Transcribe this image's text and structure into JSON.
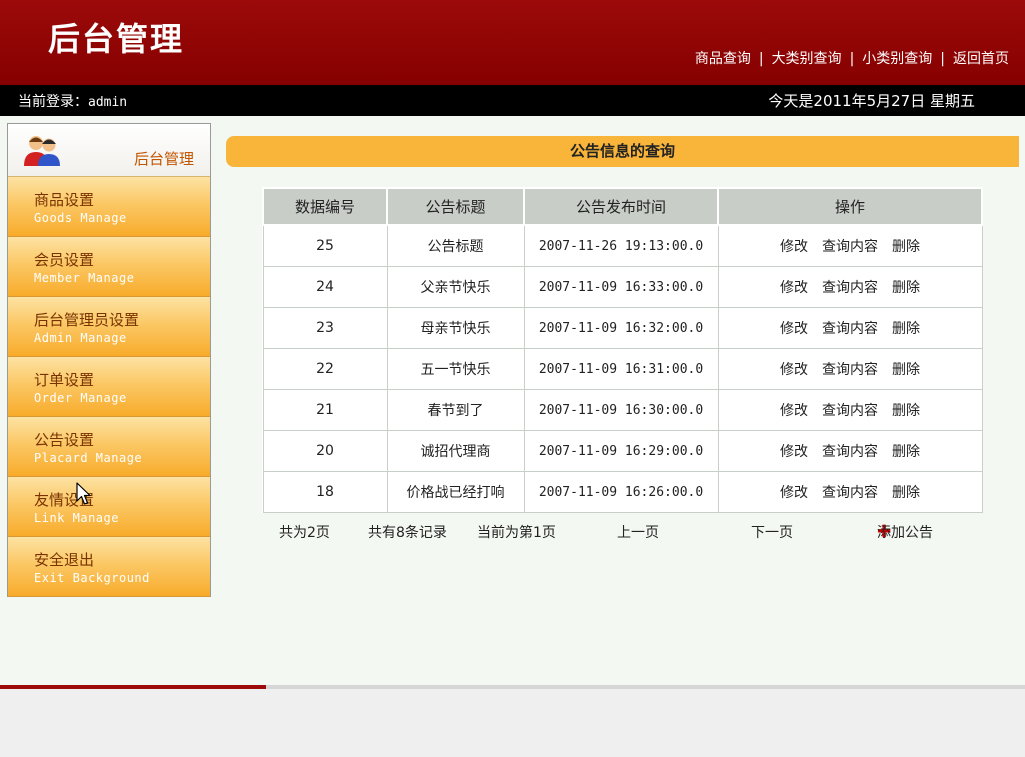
{
  "header": {
    "brand": "后台管理",
    "nav": [
      {
        "label": "商品查询"
      },
      {
        "label": "大类别查询"
      },
      {
        "label": "小类别查询"
      },
      {
        "label": "返回首页"
      }
    ]
  },
  "infobar": {
    "login_label": "当前登录：",
    "login_user": "admin",
    "date_text": "今天是2011年5月27日  星期五"
  },
  "sidebar": {
    "title": "后台管理",
    "icon": "users-icon",
    "items": [
      {
        "label": "商品设置",
        "sub": "Goods Manage"
      },
      {
        "label": "会员设置",
        "sub": "Member Manage"
      },
      {
        "label": "后台管理员设置",
        "sub": "Admin Manage"
      },
      {
        "label": "订单设置",
        "sub": "Order Manage"
      },
      {
        "label": "公告设置",
        "sub": "Placard Manage"
      },
      {
        "label": "友情设置",
        "sub": "Link Manage"
      },
      {
        "label": "安全退出",
        "sub": "Exit Background"
      }
    ]
  },
  "main": {
    "title": "公告信息的查询",
    "table": {
      "headers": [
        "数据编号",
        "公告标题",
        "公告发布时间",
        "操作"
      ],
      "actions": [
        "修改",
        "查询内容",
        "删除"
      ],
      "rows": [
        {
          "id": "25",
          "title": "公告标题",
          "time": "2007-11-26 19:13:00.0"
        },
        {
          "id": "24",
          "title": "父亲节快乐",
          "time": "2007-11-09 16:33:00.0"
        },
        {
          "id": "23",
          "title": "母亲节快乐",
          "time": "2007-11-09 16:32:00.0"
        },
        {
          "id": "22",
          "title": "五一节快乐",
          "time": "2007-11-09 16:31:00.0"
        },
        {
          "id": "21",
          "title": "春节到了",
          "time": "2007-11-09 16:30:00.0"
        },
        {
          "id": "20",
          "title": "诚招代理商",
          "time": "2007-11-09 16:29:00.0"
        },
        {
          "id": "18",
          "title": "价格战已经打响",
          "time": "2007-11-09 16:26:00.0"
        }
      ]
    },
    "pager": {
      "total_pages": "共为2页",
      "total_records": "共有8条记录",
      "current_page": "当前为第1页",
      "prev": "上一页",
      "next": "下一页",
      "add": "添加公告",
      "add_icon": "plus-icon"
    }
  },
  "colors": {
    "header_red": "#9c0a0a",
    "accent_orange": "#f8b53a",
    "sidebar_orange": "#fbc866"
  }
}
